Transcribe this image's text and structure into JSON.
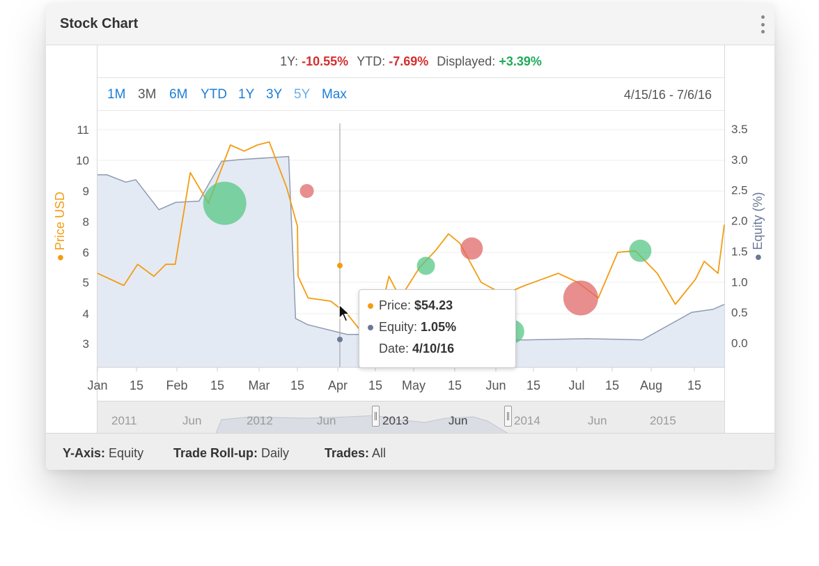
{
  "header": {
    "title": "Stock Chart",
    "menu_icon": "kebab-menu-icon"
  },
  "performance": {
    "one_year_label": "1Y:",
    "one_year_value": "-10.55%",
    "ytd_label": "YTD:",
    "ytd_value": "-7.69%",
    "displayed_label": "Displayed:",
    "displayed_value": "+3.39%"
  },
  "range_buttons": [
    {
      "label": "1M"
    },
    {
      "label": "3M"
    },
    {
      "label": "6M"
    },
    {
      "label": "YTD"
    },
    {
      "label": "1Y"
    },
    {
      "label": "3Y"
    },
    {
      "label": "5Y"
    },
    {
      "label": "Max"
    }
  ],
  "date_range": "4/15/16 - 7/6/16",
  "tooltip": {
    "price_label": "Price:",
    "price_value": "$54.23",
    "equity_label": "Equity:",
    "equity_value": "1.05%",
    "date_label": "Date:",
    "date_value": "4/10/16"
  },
  "navigator": {
    "labels": [
      "2011",
      "Jun",
      "2012",
      "Jun",
      "2013",
      "Jun",
      "2014",
      "Jun",
      "2015"
    ]
  },
  "footer": {
    "y_axis_label": "Y-Axis:",
    "y_axis_value": "Equity",
    "rollup_label": "Trade Roll-up:",
    "rollup_value": "Daily",
    "trades_label": "Trades:",
    "trades_value": "All"
  },
  "colors": {
    "price_line": "#f39c12",
    "equity_fill": "#e3e9f3",
    "equity_line": "#8e9bb2",
    "win_bubble": "#57c785",
    "loss_bubble": "#e06868",
    "accent": "#1c7ed6"
  },
  "chart_data": {
    "type": "line",
    "title": "",
    "xlabel": "",
    "ylabel": "Price USD",
    "y2label": "Equity (%)",
    "x_tick_labels": [
      "Jan",
      "15",
      "Feb",
      "15",
      "Mar",
      "15",
      "Apr",
      "15",
      "May",
      "15",
      "Jun",
      "15",
      "Jul",
      "15",
      "Aug",
      "15"
    ],
    "y_ticks": [
      "11",
      "10",
      "9",
      "8",
      "6",
      "5",
      "4",
      "3"
    ],
    "y2_ticks": [
      "3.5",
      "3.0",
      "2.5",
      "2.0",
      "1.5",
      "1.0",
      "0.5",
      "0.0"
    ],
    "y2lim": [
      0.0,
      3.5
    ],
    "grid": true,
    "series": [
      {
        "name": "Price USD",
        "x": [
          0.0,
          0.042,
          0.064,
          0.09,
          0.109,
          0.124,
          0.148,
          0.177,
          0.212,
          0.234,
          0.255,
          0.274,
          0.302,
          0.319,
          0.32,
          0.336,
          0.372,
          0.398,
          0.421,
          0.444,
          0.465,
          0.483,
          0.514,
          0.539,
          0.56,
          0.578,
          0.612,
          0.649,
          0.67,
          0.682,
          0.709,
          0.735,
          0.766,
          0.799,
          0.83,
          0.858,
          0.893,
          0.922,
          0.954,
          0.968,
          0.99,
          1.0
        ],
        "values": [
          5.3,
          4.9,
          5.6,
          5.2,
          5.6,
          5.6,
          9.6,
          8.6,
          10.5,
          10.3,
          10.5,
          10.6,
          9.1,
          7.7,
          5.2,
          4.5,
          4.4,
          4.0,
          3.4,
          3.4,
          5.2,
          4.5,
          5.5,
          6.1,
          7.2,
          6.6,
          5.0,
          4.6,
          4.8,
          4.9,
          5.1,
          5.3,
          5.0,
          4.5,
          6.0,
          6.1,
          5.3,
          4.3,
          5.1,
          5.7,
          5.3,
          7.8
        ]
      },
      {
        "name": "Equity (%)",
        "x": [
          0.0,
          0.015,
          0.045,
          0.061,
          0.098,
          0.125,
          0.162,
          0.198,
          0.228,
          0.305,
          0.316,
          0.335,
          0.398,
          0.421,
          0.507,
          0.611,
          0.688,
          0.781,
          0.869,
          0.948,
          0.982,
          1.0
        ],
        "values": [
          2.75,
          2.75,
          2.63,
          2.67,
          2.18,
          2.3,
          2.32,
          2.97,
          3.0,
          3.05,
          0.4,
          0.3,
          0.14,
          0.14,
          0.05,
          0.05,
          0.05,
          0.07,
          0.05,
          0.5,
          0.55,
          0.63
        ]
      }
    ],
    "trades": [
      {
        "x": 0.203,
        "y": 8.6,
        "result": "win",
        "size": 31
      },
      {
        "x": 0.334,
        "y": 9.0,
        "result": "loss",
        "size": 10
      },
      {
        "x": 0.524,
        "y": 5.55,
        "result": "win",
        "size": 13
      },
      {
        "x": 0.597,
        "y": 6.25,
        "result": "loss",
        "size": 16
      },
      {
        "x": 0.662,
        "y": 3.4,
        "result": "win",
        "size": 17
      },
      {
        "x": 0.771,
        "y": 4.5,
        "result": "loss",
        "size": 25
      },
      {
        "x": 0.866,
        "y": 6.1,
        "result": "win",
        "size": 16
      }
    ],
    "crosshair": {
      "date": "4/10/16",
      "price": 54.23,
      "equity": 1.05
    }
  }
}
